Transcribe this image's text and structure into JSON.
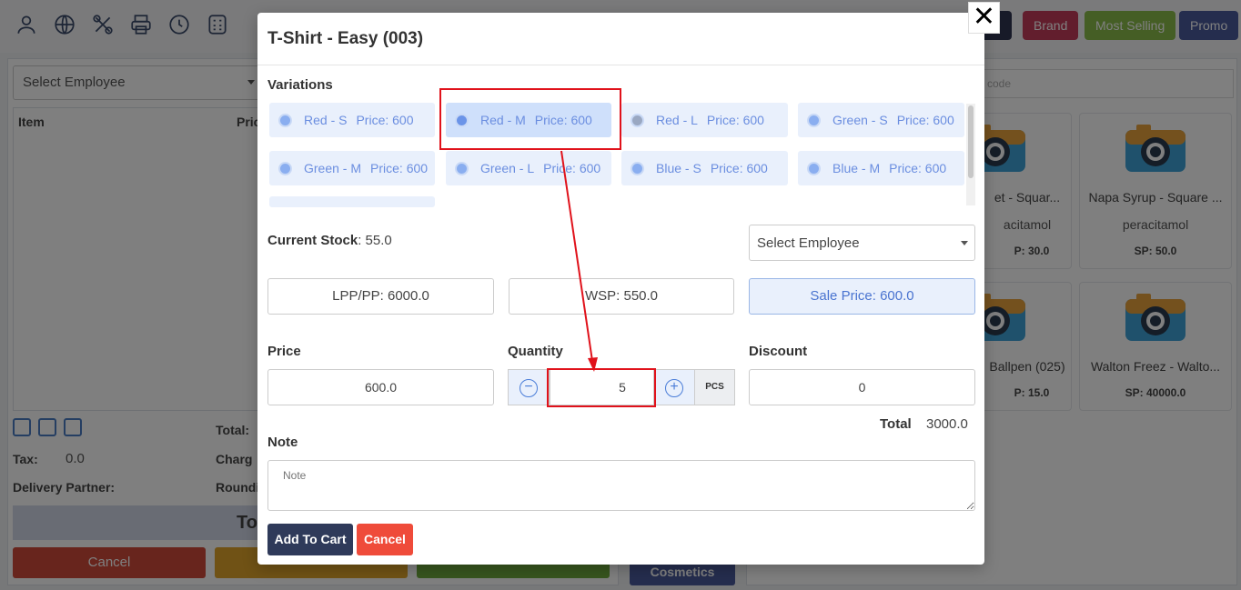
{
  "background": {
    "top_icons": [
      "user-icon",
      "globe-icon",
      "settings-cross-icon",
      "printer-icon",
      "history-icon",
      "calculator-icon"
    ],
    "tags": {
      "brand": "Brand",
      "most_selling": "Most Selling",
      "promo": "Promo"
    },
    "employee_select": "Select Employee",
    "table_headers": {
      "item": "Item",
      "price_partial": "Pric"
    },
    "tax_label": "Tax:",
    "tax_value": "0.0",
    "delivery_label": "Delivery Partner:",
    "total_label_partial": "Total:",
    "charge_label_partial": "Charg",
    "round_label_partial": "Roundi",
    "total_bar_partial": "To",
    "cancel_label": "Cancel",
    "cosmetics": "Cosmetics",
    "search_placeholder_partial": "code",
    "products": [
      {
        "name": "et - Squar...",
        "generic": "acitamol",
        "sp": "P: 30.0"
      },
      {
        "name": "Napa Syrup - Square ...",
        "generic": "peracitamol",
        "sp": "SP: 50.0"
      },
      {
        "name": "Ballpen (025)",
        "generic": "",
        "sp": "P: 15.0"
      },
      {
        "name": "Walton Freez - Walto...",
        "generic": "",
        "sp": "SP: 40000.0"
      }
    ]
  },
  "modal": {
    "title": "T-Shirt - Easy (003)",
    "close_symbol": "✕",
    "variations_label": "Variations",
    "variations": [
      {
        "name": "Red - S",
        "price": "Price: 600"
      },
      {
        "name": "Red - M",
        "price": "Price: 600"
      },
      {
        "name": "Red - L",
        "price": "Price: 600"
      },
      {
        "name": "Green - S",
        "price": "Price: 600"
      },
      {
        "name": "Green - M",
        "price": "Price: 600"
      },
      {
        "name": "Green - L",
        "price": "Price: 600"
      },
      {
        "name": "Blue - S",
        "price": "Price: 600"
      },
      {
        "name": "Blue - M",
        "price": "Price: 600"
      }
    ],
    "selected_variation": "Red - M",
    "current_stock_label": "Current Stock",
    "current_stock_value": ": 55.0",
    "employee_select": "Select Employee",
    "lpp": "LPP/PP: 6000.0",
    "wsp": "WSP: 550.0",
    "sale_price": "Sale Price: 600.0",
    "price_label": "Price",
    "price_value": "600.0",
    "quantity_label": "Quantity",
    "quantity_value": "5",
    "quantity_unit": "PCS",
    "discount_label": "Discount",
    "discount_value": "0",
    "total_label": "Total",
    "total_value": "3000.0",
    "note_label": "Note",
    "note_placeholder": "Note",
    "add_to_cart": "Add To Cart",
    "cancel": "Cancel"
  },
  "colors": {
    "primary_dark": "#2f3a5a",
    "danger": "#ef4b3a",
    "variation_bg": "#e9f0fc",
    "annotation_red": "#e0121b"
  }
}
